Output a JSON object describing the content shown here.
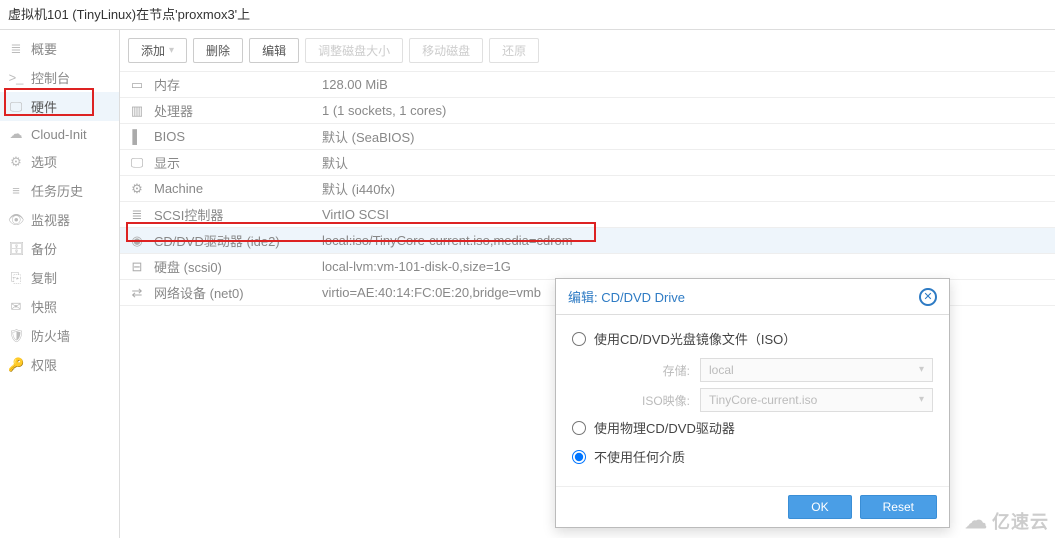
{
  "header": {
    "title": "虚拟机101 (TinyLinux)在节点'proxmox3'上"
  },
  "sidebar": {
    "items": [
      {
        "label": "概要",
        "icon": "≣"
      },
      {
        "label": "控制台",
        "icon": ">_"
      },
      {
        "label": "硬件",
        "icon": "🖵"
      },
      {
        "label": "Cloud-Init",
        "icon": "☁"
      },
      {
        "label": "选项",
        "icon": "⚙"
      },
      {
        "label": "任务历史",
        "icon": "≡"
      },
      {
        "label": "监视器",
        "icon": "👁"
      },
      {
        "label": "备份",
        "icon": "🗄"
      },
      {
        "label": "复制",
        "icon": "⎘"
      },
      {
        "label": "快照",
        "icon": "✉"
      },
      {
        "label": "防火墙",
        "icon": "🛡"
      },
      {
        "label": "权限",
        "icon": "🔑"
      }
    ]
  },
  "toolbar": {
    "add": "添加",
    "remove": "删除",
    "edit": "编辑",
    "resize": "调整磁盘大小",
    "move": "移动磁盘",
    "revert": "还原"
  },
  "hardware": {
    "rows": [
      {
        "icon": "▭",
        "label": "内存",
        "value": "128.00 MiB"
      },
      {
        "icon": "▥",
        "label": "处理器",
        "value": "1 (1 sockets, 1 cores)"
      },
      {
        "icon": "▌",
        "label": "BIOS",
        "value": "默认 (SeaBIOS)"
      },
      {
        "icon": "🖵",
        "label": "显示",
        "value": "默认"
      },
      {
        "icon": "⚙",
        "label": "Machine",
        "value": "默认 (i440fx)"
      },
      {
        "icon": "≣",
        "label": "SCSI控制器",
        "value": "VirtIO SCSI"
      },
      {
        "icon": "◉",
        "label": "CD/DVD驱动器 (ide2)",
        "value": "local:iso/TinyCore-current.iso,media=cdrom"
      },
      {
        "icon": "⊟",
        "label": "硬盘 (scsi0)",
        "value": "local-lvm:vm-101-disk-0,size=1G"
      },
      {
        "icon": "⇄",
        "label": "网络设备 (net0)",
        "value": "virtio=AE:40:14:FC:0E:20,bridge=vmb"
      }
    ]
  },
  "modal": {
    "title": "编辑: CD/DVD Drive",
    "opt_iso": "使用CD/DVD光盘镜像文件（ISO）",
    "storage_label": "存储:",
    "storage_value": "local",
    "iso_label": "ISO映像:",
    "iso_value": "TinyCore-current.iso",
    "opt_physical": "使用物理CD/DVD驱动器",
    "opt_none": "不使用任何介质",
    "ok": "OK",
    "reset": "Reset"
  },
  "watermark": "亿速云"
}
